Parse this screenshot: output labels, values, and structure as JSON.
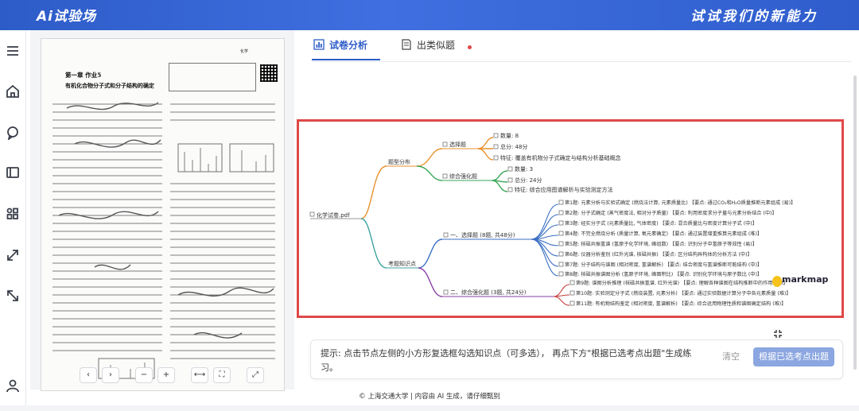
{
  "header": {
    "logo": "Ai试验场",
    "slogan": "试试我们的新能力"
  },
  "rail": {
    "icons": [
      "menu-icon",
      "home-icon",
      "chat-icon",
      "panel-icon",
      "apps-icon",
      "expand-icon",
      "collapse-icon",
      "user-icon"
    ]
  },
  "doc": {
    "header_text": "化学",
    "title1": "第一章  作业5",
    "title2": "有机化合物分子式和分子结构的确定",
    "toolbar": [
      "‹",
      "›",
      "−",
      "+",
      "⟷",
      "⛶",
      "⤢"
    ]
  },
  "tabs": {
    "active": "试卷分析",
    "second": "出类似题"
  },
  "mindmap": {
    "root": "化学试卷.pdf",
    "branch_type": "题型分布",
    "branch_knowledge": "考题知识点",
    "type_choice": "选择题",
    "type_comp": "综合强化题",
    "choice_count": "数量: 8",
    "choice_score": "总分: 48分",
    "choice_feature": "特征: 覆盖有机物分子式确定与结构分析基础概念",
    "comp_count": "数量: 3",
    "comp_score": "总分: 24分",
    "comp_feature": "特征: 综合应用图谱解析与实验测定方法",
    "sec_choice": "一、选择题 (8题, 共48分)",
    "sec_comp": "二、综合强化题 (3题, 共24分)",
    "q": [
      "第1题: 元素分析与实验式确定 (燃烧法计算, 元素质量比) 【要点: 通过CO₂和H₂O质量推断元素组成 (易)】",
      "第2题: 分子式确定 (蒸气密度法, 相对分子质量) 【要点: 利用密度求分子量与元素分析结合 (中)】",
      "第3题: 经实分子式 (元素质量比, 气体密度) 【要点: 混合质量比与密度计算分子式 (中)】",
      "第4题: 不完全燃烧分析 (质量计算, 氧元素确定) 【要点: 通过装置增重推算元素组成 (难)】",
      "第5题: 核磁共振氢谱 (氢原子化学环境, 峰组数) 【要点: 识别分子中氢原子等效性 (易)】",
      "第6题: 仪器分析鉴别 (红外光谱, 核磁共振) 【要点: 区分结构异构体的分析方法 (中)】",
      "第7题: 分子结构与谱图 (相对密度, 氢谱解析) 【要点: 结合密度与氢谱推断可能结构 (中)】",
      "第8题: 核磁共振谱图分析 (氢原子环境, 峰面积比) 【要点: 识别化学环境与原子数比 (中)】",
      "第9题: 谱图分析推理 (核磁共振氢谱, 红外光谱) 【要点: 理解各种谱图在结构推断中的作用 (易)】",
      "第10题: 实验测定分子式 (燃烧装置, 元素分析) 【要点: 通过实验数据计算分子中各元素质量 (难)】",
      "第11题: 有机物结构鉴定 (相对密度, 氢谱解析) 【要点: 综合运用物理性质和谱图确定结构 (难)】"
    ]
  },
  "markmap": {
    "label": "markmap"
  },
  "hint": {
    "text": "提示:  点击节点左侧的小方形复选框勾选知识点（可多选），  再点下方\"根据已选考点出题\"生成练习。",
    "clear": "清空",
    "generate": "根据已选考点出题"
  },
  "footer": {
    "text": "© 上海交通大学 | 内容由 AI 生成，请仔细甄别"
  },
  "colors": {
    "brand": "#2d5cc8",
    "highlight_frame": "#e04848",
    "branch_orange": "#e8912d",
    "branch_teal": "#3fa4a0",
    "branch_green": "#3aa655",
    "branch_purple": "#8b3fa6",
    "branch_blue": "#3a6fc4",
    "branch_red": "#c43a3a"
  }
}
